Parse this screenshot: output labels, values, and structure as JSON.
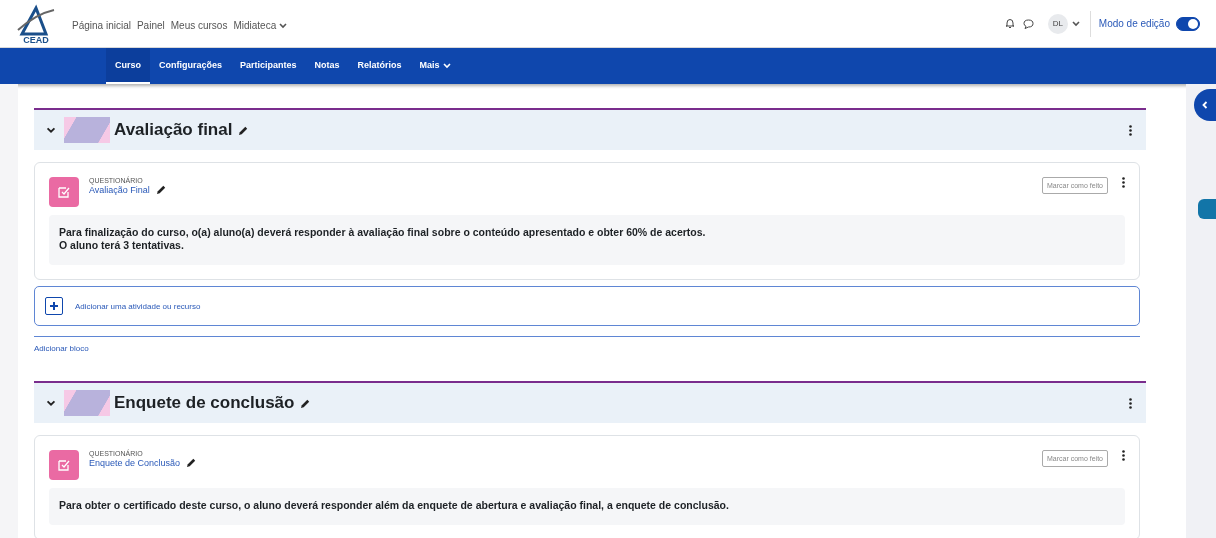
{
  "header": {
    "logo_text": "CEAD",
    "nav": [
      {
        "label": "Página inicial",
        "dropdown": false
      },
      {
        "label": "Painel",
        "dropdown": false
      },
      {
        "label": "Meus cursos",
        "dropdown": false
      },
      {
        "label": "Midiateca",
        "dropdown": true
      }
    ],
    "user_initials": "DL",
    "edit_mode": {
      "label": "Modo de edição",
      "on": true
    }
  },
  "course_nav": [
    {
      "label": "Curso",
      "selected": true,
      "dropdown": false
    },
    {
      "label": "Configurações",
      "selected": false,
      "dropdown": false
    },
    {
      "label": "Participantes",
      "selected": false,
      "dropdown": false
    },
    {
      "label": "Notas",
      "selected": false,
      "dropdown": false
    },
    {
      "label": "Relatórios",
      "selected": false,
      "dropdown": false
    },
    {
      "label": "Mais",
      "selected": false,
      "dropdown": true
    }
  ],
  "sections": [
    {
      "title": "Avaliação final",
      "expanded": true,
      "activities": [
        {
          "type": "QUESTIONÁRIO",
          "name": "Avaliação Final",
          "completion": "Marcar como feito",
          "description": [
            "Para finalização do curso, o(a)  aluno(a)  deverá responder à avaliação final sobre o conteúdo apresentado e obter 60% de acertos.",
            "O aluno terá 3 tentativas."
          ]
        }
      ],
      "add_activity": "Adicionar uma atividade ou recurso",
      "add_block": "Adicionar bloco"
    },
    {
      "title": "Enquete de conclusão",
      "expanded": true,
      "activities": [
        {
          "type": "QUESTIONÁRIO",
          "name": "Enquete de Conclusão",
          "completion": "Marcar como feito",
          "description": [
            "Para obter o certificado deste curso, o aluno deverá responder além da enquete de abertura e avaliação final, a enquete de conclusão."
          ]
        }
      ]
    }
  ]
}
